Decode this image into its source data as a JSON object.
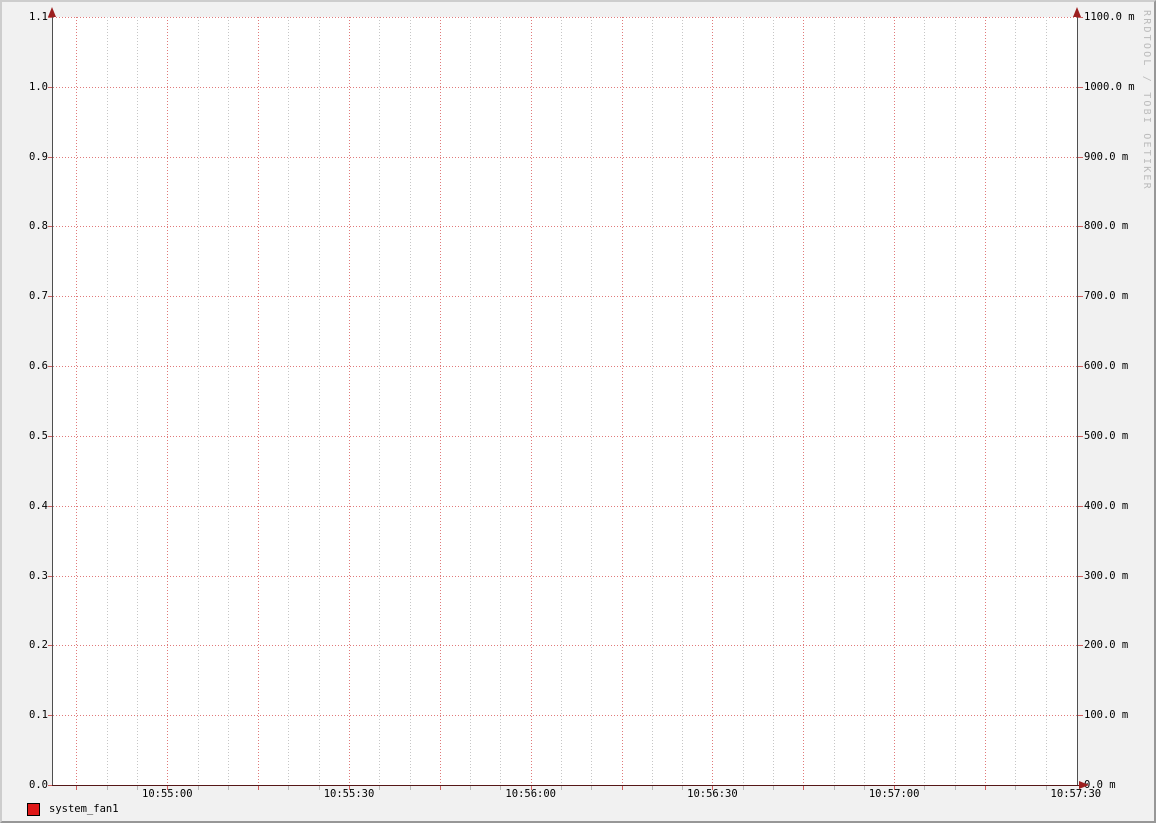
{
  "chart_data": {
    "type": "line",
    "renderer": "rrdtool",
    "title": "",
    "watermark": "RRDTOOL / TOBI OETIKER",
    "x_ticks": [
      "10:55:00",
      "10:55:30",
      "10:56:00",
      "10:56:30",
      "10:57:00",
      "10:57:30"
    ],
    "x_range": [
      "10:55:00",
      "10:57:30"
    ],
    "x_label_interval_seconds": 30,
    "x_major_grid_seconds": 15,
    "x_minor_grid_seconds": 5,
    "y_left": {
      "min": 0.0,
      "max": 1.1,
      "step": 0.1,
      "ticks": [
        "0.0",
        "0.1",
        "0.2",
        "0.3",
        "0.4",
        "0.5",
        "0.6",
        "0.7",
        "0.8",
        "0.9",
        "1.0",
        "1.1"
      ]
    },
    "y_right": {
      "unit": "m",
      "ticks": [
        "0.0 m",
        "100.0 m",
        "200.0 m",
        "300.0 m",
        "400.0 m",
        "500.0 m",
        "600.0 m",
        "700.0 m",
        "800.0 m",
        "900.0 m",
        "1000.0 m",
        "1100.0 m"
      ]
    },
    "series": [
      {
        "name": "system_fan1",
        "color": "#df1717",
        "values": []
      }
    ],
    "legend": [
      {
        "label": "system_fan1",
        "swatch_color": "#df1717"
      }
    ],
    "grid": {
      "enabled": true,
      "minor_color": "#c6c6c6",
      "major_color": "#e07a7a"
    },
    "colors": {
      "background": "#f1f1f1",
      "canvas": "#ffffff",
      "axis": "#4f4f4f",
      "x_axis": "#551717",
      "arrow": "#9c1f1f",
      "text": "#000000",
      "watermark": "#bbbbbb",
      "border_light": "#cdcdcd",
      "border_dark": "#979797"
    }
  }
}
